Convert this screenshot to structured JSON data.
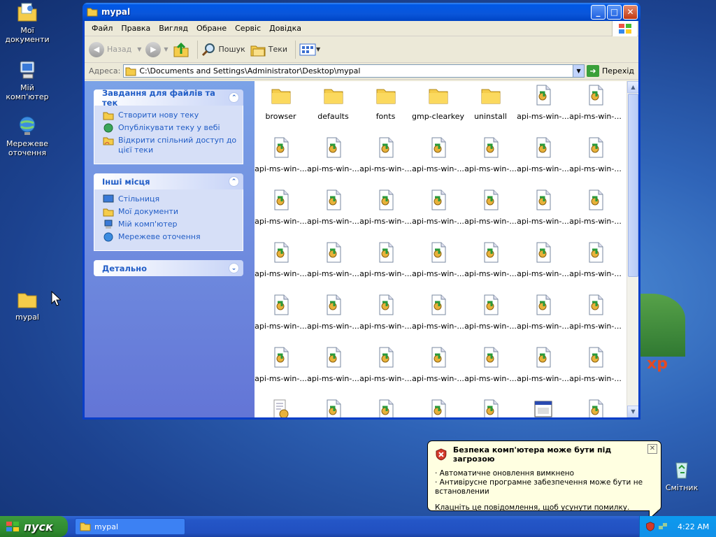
{
  "desktop": {
    "icons": [
      {
        "label": "Мої документи"
      },
      {
        "label": "Мій комп'ютер"
      },
      {
        "label": "Мережеве оточення"
      },
      {
        "label": "mypal"
      },
      {
        "label": "Смітник"
      }
    ],
    "logo_text": "xp"
  },
  "window": {
    "title": "mypal",
    "menu": [
      "Файл",
      "Правка",
      "Вигляд",
      "Обране",
      "Сервіс",
      "Довідка"
    ],
    "toolbar": {
      "back": "Назад",
      "search": "Пошук",
      "folders": "Теки"
    },
    "address": {
      "label": "Адреса:",
      "path": "C:\\Documents and Settings\\Administrator\\Desktop\\mypal",
      "go": "Перехід"
    },
    "panels": [
      {
        "title": "Завдання для файлів та тек",
        "items": [
          "Створити нову теку",
          "Опублікувати теку у вебі",
          "Відкрити спільний доступ до цієї теки"
        ]
      },
      {
        "title": "Інші місця",
        "items": [
          "Стільниця",
          "Мої документи",
          "Мій комп'ютер",
          "Мережеве оточення"
        ]
      },
      {
        "title": "Детально",
        "items": []
      }
    ],
    "files": [
      {
        "name": "browser",
        "type": "folder"
      },
      {
        "name": "defaults",
        "type": "folder"
      },
      {
        "name": "fonts",
        "type": "folder"
      },
      {
        "name": "gmp-clearkey",
        "type": "folder"
      },
      {
        "name": "uninstall",
        "type": "folder"
      },
      {
        "name": "api-ms-win-...",
        "type": "dll"
      },
      {
        "name": "api-ms-win-...",
        "type": "dll"
      },
      {
        "name": "api-ms-win-...",
        "type": "dll"
      },
      {
        "name": "api-ms-win-...",
        "type": "dll"
      },
      {
        "name": "api-ms-win-...",
        "type": "dll"
      },
      {
        "name": "api-ms-win-...",
        "type": "dll"
      },
      {
        "name": "api-ms-win-...",
        "type": "dll"
      },
      {
        "name": "api-ms-win-...",
        "type": "dll"
      },
      {
        "name": "api-ms-win-...",
        "type": "dll"
      },
      {
        "name": "api-ms-win-...",
        "type": "dll"
      },
      {
        "name": "api-ms-win-...",
        "type": "dll"
      },
      {
        "name": "api-ms-win-...",
        "type": "dll"
      },
      {
        "name": "api-ms-win-...",
        "type": "dll"
      },
      {
        "name": "api-ms-win-...",
        "type": "dll"
      },
      {
        "name": "api-ms-win-...",
        "type": "dll"
      },
      {
        "name": "api-ms-win-...",
        "type": "dll"
      },
      {
        "name": "api-ms-win-...",
        "type": "dll"
      },
      {
        "name": "api-ms-win-...",
        "type": "dll"
      },
      {
        "name": "api-ms-win-...",
        "type": "dll"
      },
      {
        "name": "api-ms-win-...",
        "type": "dll"
      },
      {
        "name": "api-ms-win-...",
        "type": "dll"
      },
      {
        "name": "api-ms-win-...",
        "type": "dll"
      },
      {
        "name": "api-ms-win-...",
        "type": "dll"
      },
      {
        "name": "api-ms-win-...",
        "type": "dll"
      },
      {
        "name": "api-ms-win-...",
        "type": "dll"
      },
      {
        "name": "api-ms-win-...",
        "type": "dll"
      },
      {
        "name": "api-ms-win-...",
        "type": "dll"
      },
      {
        "name": "api-ms-win-...",
        "type": "dll"
      },
      {
        "name": "api-ms-win-...",
        "type": "dll"
      },
      {
        "name": "api-ms-win-...",
        "type": "dll"
      },
      {
        "name": "api-ms-win-...",
        "type": "dll"
      },
      {
        "name": "api-ms-win-...",
        "type": "dll"
      },
      {
        "name": "api-ms-win-...",
        "type": "dll"
      },
      {
        "name": "api-ms-win-...",
        "type": "dll"
      },
      {
        "name": "api-ms-win-...",
        "type": "dll"
      },
      {
        "name": "api-ms-win-...",
        "type": "dll"
      },
      {
        "name": "api-ms-win-...",
        "type": "dll"
      },
      {
        "name": "",
        "type": "config"
      },
      {
        "name": "",
        "type": "dll"
      },
      {
        "name": "",
        "type": "dll"
      },
      {
        "name": "",
        "type": "dll"
      },
      {
        "name": "",
        "type": "dll"
      },
      {
        "name": "",
        "type": "exe"
      },
      {
        "name": "",
        "type": "dll"
      }
    ]
  },
  "taskbar": {
    "start": "пуск",
    "task": "mypal",
    "clock": "4:22 AM"
  },
  "balloon": {
    "title": "Безпека комп'ютера може бути під загрозою",
    "lines": [
      "· Автоматичне оновлення вимкнено",
      "· Антивірусне програмне забезпечення може бути не встановлении"
    ],
    "footer": "Клацніть це повідомлення, щоб усунути помилку."
  },
  "colors": {
    "accent": "#0a56da",
    "link": "#215dc6",
    "start": "#2f8a2f"
  }
}
